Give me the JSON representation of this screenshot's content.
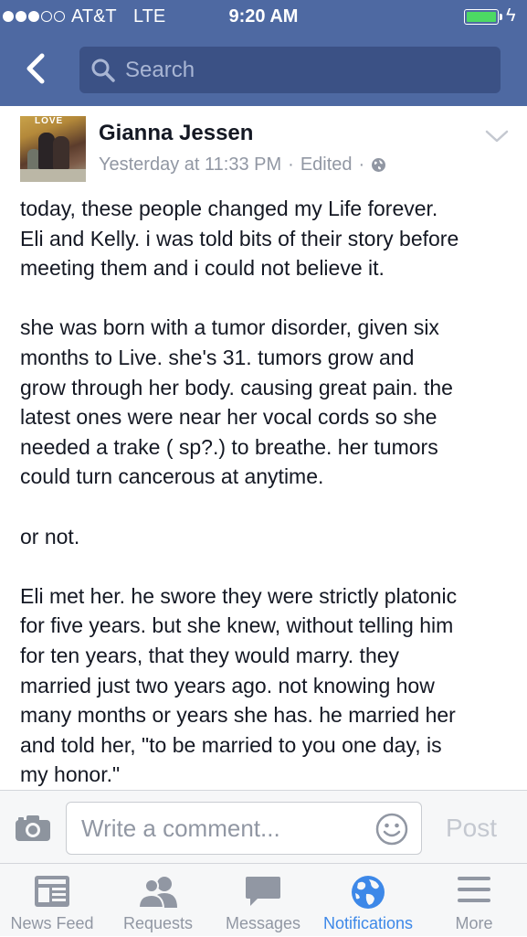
{
  "status_bar": {
    "carrier": "AT&T",
    "network": "LTE",
    "time": "9:20 AM",
    "signal_bars": 3,
    "battery_level": 1.0,
    "battery_color": "#4cd964"
  },
  "nav": {
    "back_icon": "chevron-left-icon",
    "search_placeholder": "Search"
  },
  "post": {
    "author": "Gianna Jessen",
    "timestamp": "Yesterday at 11:33 PM",
    "edited": "Edited",
    "privacy_icon": "globe-icon",
    "avatar_label": "LOVE",
    "paragraphs": [
      "today, these people changed my Life forever.\nEli and Kelly. i was told bits of their story before\nmeeting them and i could not believe it.",
      "she was born with a tumor disorder, given six\nmonths to Live. she's 31. tumors grow and\ngrow through her body. causing great pain. the\nlatest ones were near her vocal cords so she\nneeded a trake ( sp?.) to breathe. her tumors\ncould turn cancerous at anytime.",
      "or not.",
      "Eli met her. he swore they were strictly platonic\nfor five years. but she knew, without telling him\nfor ten years, that they would marry. they\nmarried just two years ago. not knowing how\nmany months or years she has. he married her\nand told her, \"to be married to you one day, is\nmy honor.\""
    ]
  },
  "comment_bar": {
    "placeholder": "Write a comment...",
    "post_label": "Post"
  },
  "tabs": [
    {
      "label": "News Feed",
      "icon": "news-feed-icon",
      "active": false
    },
    {
      "label": "Requests",
      "icon": "friend-requests-icon",
      "active": false
    },
    {
      "label": "Messages",
      "icon": "messages-icon",
      "active": false
    },
    {
      "label": "Notifications",
      "icon": "globe-icon",
      "active": true
    },
    {
      "label": "More",
      "icon": "menu-icon",
      "active": false
    }
  ],
  "colors": {
    "header": "#4e69a2",
    "search_bg": "#3b5185",
    "active_tab": "#3d88e8",
    "inactive_tab": "#9197a3"
  }
}
